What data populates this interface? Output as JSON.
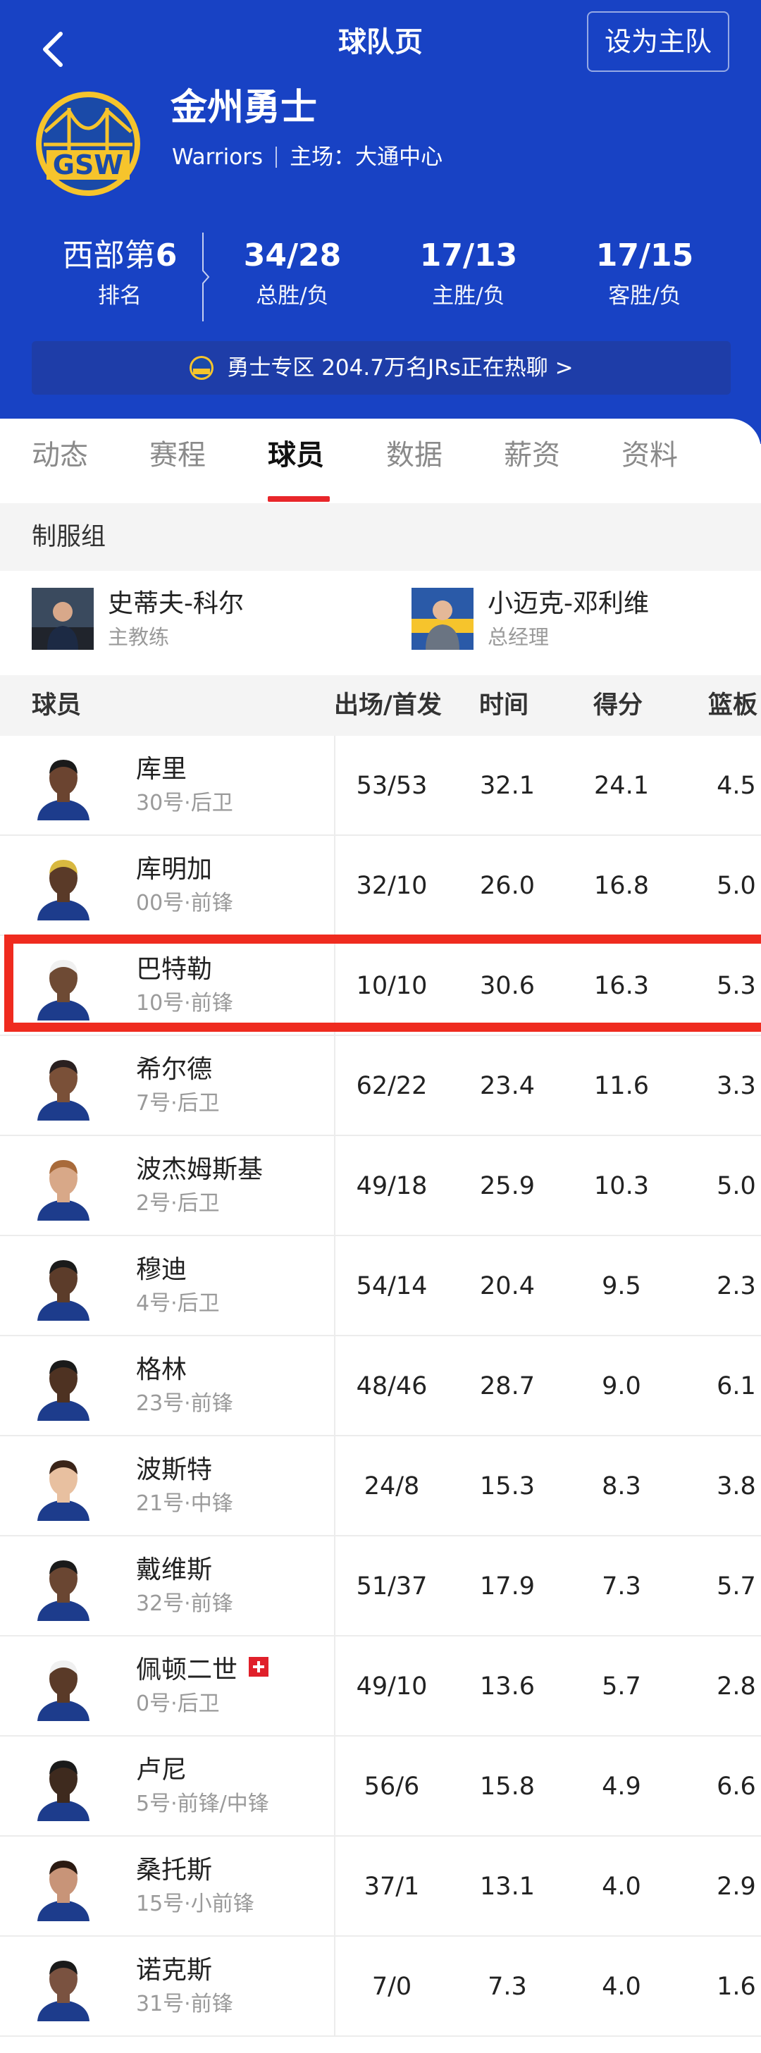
{
  "header": {
    "title": "球队页",
    "set_home_label": "设为主队",
    "team_name": "金州勇士",
    "team_en": "Warriors",
    "venue_label": "主场：",
    "venue": "大通中心",
    "brand_color": "#1842c4",
    "logo_text": "GSW"
  },
  "stats": {
    "rank_prefix": "西部第",
    "rank_num": "6",
    "rank_label": "排名",
    "total": "34/28",
    "total_label": "总胜/负",
    "home": "17/13",
    "home_label": "主胜/负",
    "away": "17/15",
    "away_label": "客胜/负"
  },
  "banner": {
    "text": "勇士专区 204.7万名JRs正在热聊 >"
  },
  "tabs": [
    {
      "label": "动态"
    },
    {
      "label": "赛程"
    },
    {
      "label": "球员"
    },
    {
      "label": "数据"
    },
    {
      "label": "薪资"
    },
    {
      "label": "资料"
    }
  ],
  "active_tab": "球员",
  "staff": {
    "title": "制服组",
    "members": [
      {
        "name": "史蒂夫-科尔",
        "role": "主教练"
      },
      {
        "name": "小迈克-邓利维",
        "role": "总经理"
      }
    ]
  },
  "table": {
    "headers": {
      "player": "球员",
      "gp": "出场/首发",
      "min": "时间",
      "pts": "得分",
      "reb": "篮板"
    },
    "rows": [
      {
        "name": "库里",
        "info": "30号·后卫",
        "gp": "53/53",
        "min": "32.1",
        "pts": "24.1",
        "reb": "4.5"
      },
      {
        "name": "库明加",
        "info": "00号·前锋",
        "gp": "32/10",
        "min": "26.0",
        "pts": "16.8",
        "reb": "5.0"
      },
      {
        "name": "巴特勒",
        "info": "10号·前锋",
        "gp": "10/10",
        "min": "30.6",
        "pts": "16.3",
        "reb": "5.3"
      },
      {
        "name": "希尔德",
        "info": "7号·后卫",
        "gp": "62/22",
        "min": "23.4",
        "pts": "11.6",
        "reb": "3.3"
      },
      {
        "name": "波杰姆斯基",
        "info": "2号·后卫",
        "gp": "49/18",
        "min": "25.9",
        "pts": "10.3",
        "reb": "5.0"
      },
      {
        "name": "穆迪",
        "info": "4号·后卫",
        "gp": "54/14",
        "min": "20.4",
        "pts": "9.5",
        "reb": "2.3"
      },
      {
        "name": "格林",
        "info": "23号·前锋",
        "gp": "48/46",
        "min": "28.7",
        "pts": "9.0",
        "reb": "6.1"
      },
      {
        "name": "波斯特",
        "info": "21号·中锋",
        "gp": "24/8",
        "min": "15.3",
        "pts": "8.3",
        "reb": "3.8"
      },
      {
        "name": "戴维斯",
        "info": "32号·前锋",
        "gp": "51/37",
        "min": "17.9",
        "pts": "7.3",
        "reb": "5.7"
      },
      {
        "name": "佩顿二世",
        "info": "0号·后卫",
        "gp": "49/10",
        "min": "13.6",
        "pts": "5.7",
        "reb": "2.8"
      },
      {
        "name": "卢尼",
        "info": "5号·前锋/中锋",
        "gp": "56/6",
        "min": "15.8",
        "pts": "4.9",
        "reb": "6.6"
      },
      {
        "name": "桑托斯",
        "info": "15号·小前锋",
        "gp": "37/1",
        "min": "13.1",
        "pts": "4.0",
        "reb": "2.9"
      },
      {
        "name": "诺克斯",
        "info": "31号·前锋",
        "gp": "7/0",
        "min": "7.3",
        "pts": "4.0",
        "reb": "1.6"
      }
    ]
  },
  "colors": {
    "accent": "#e8262a",
    "highlight": "#ef2b1f",
    "logo_blue": "#1a4aa8",
    "logo_gold": "#f6c42c"
  }
}
